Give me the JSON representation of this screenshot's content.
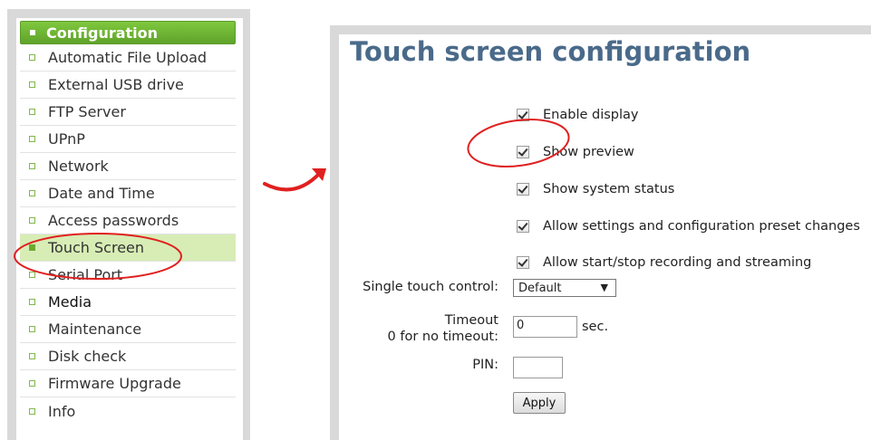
{
  "sidebar": {
    "header": "Configuration",
    "items": [
      {
        "label": "Automatic File Upload"
      },
      {
        "label": "External USB drive"
      },
      {
        "label": "FTP Server"
      },
      {
        "label": "UPnP"
      },
      {
        "label": "Network"
      },
      {
        "label": "Date and Time"
      },
      {
        "label": "Access passwords"
      },
      {
        "label": "Touch Screen",
        "active": true
      },
      {
        "label": "Serial Port"
      },
      {
        "label": "Media"
      },
      {
        "label": "Maintenance"
      },
      {
        "label": "Disk check"
      },
      {
        "label": "Firmware Upgrade"
      },
      {
        "label": "Info"
      }
    ]
  },
  "main": {
    "title": "Touch screen configuration",
    "checkboxes": [
      {
        "label": "Enable display",
        "checked": true
      },
      {
        "label": "Show preview",
        "checked": true
      },
      {
        "label": "Show system status",
        "checked": true
      },
      {
        "label": "Allow settings and configuration preset changes",
        "checked": true
      },
      {
        "label": "Allow start/stop recording and streaming",
        "checked": true
      }
    ],
    "single_touch_label": "Single touch control:",
    "single_touch_value": "Default",
    "timeout_label_1": "Timeout",
    "timeout_label_2": "0 for no timeout:",
    "timeout_value": "0",
    "timeout_unit": "sec.",
    "pin_label": "PIN:",
    "pin_value": "",
    "apply_label": "Apply"
  },
  "colors": {
    "accent_green": "#6aaa30",
    "active_bg": "#d7edb5",
    "title_blue": "#4a6a8a",
    "annotation_red": "#e02020"
  }
}
